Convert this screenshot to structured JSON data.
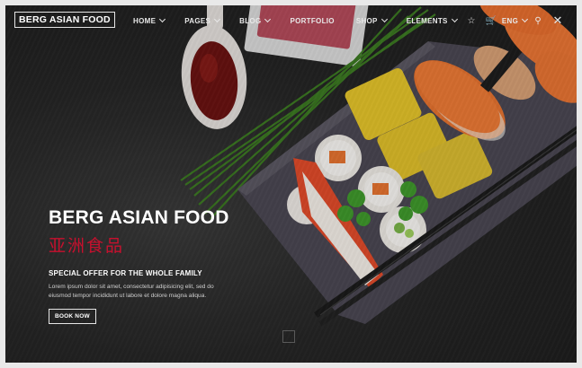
{
  "nav": {
    "logo": "BERG ASIAN FOOD",
    "menu": [
      {
        "label": "HOME",
        "has_dropdown": true
      },
      {
        "label": "PAGES",
        "has_dropdown": true
      },
      {
        "label": "BLOG",
        "has_dropdown": true
      },
      {
        "label": "PORTFOLIO",
        "has_dropdown": false
      },
      {
        "label": "SHOP",
        "has_dropdown": true
      },
      {
        "label": "ELEMENTS",
        "has_dropdown": true
      }
    ],
    "language": "ENG",
    "icons": [
      "star-icon",
      "cart-icon",
      "search-icon",
      "close-icon"
    ]
  },
  "hero": {
    "title": "BERG ASIAN FOOD",
    "subtitle_cn": "亚洲食品",
    "offer": "SPECIAL OFFER FOR THE WHOLE FAMILY",
    "description": "Lorem ipsum dolor sit amet, consectetur adipisicing elit, sed do eiusmod tempor incididunt ut labore et dolore magna aliqua.",
    "button": "BOOK NOW"
  },
  "colors": {
    "accent_red": "#c8102e",
    "background": "#1e1e1e",
    "salmon": "#e8732f"
  }
}
